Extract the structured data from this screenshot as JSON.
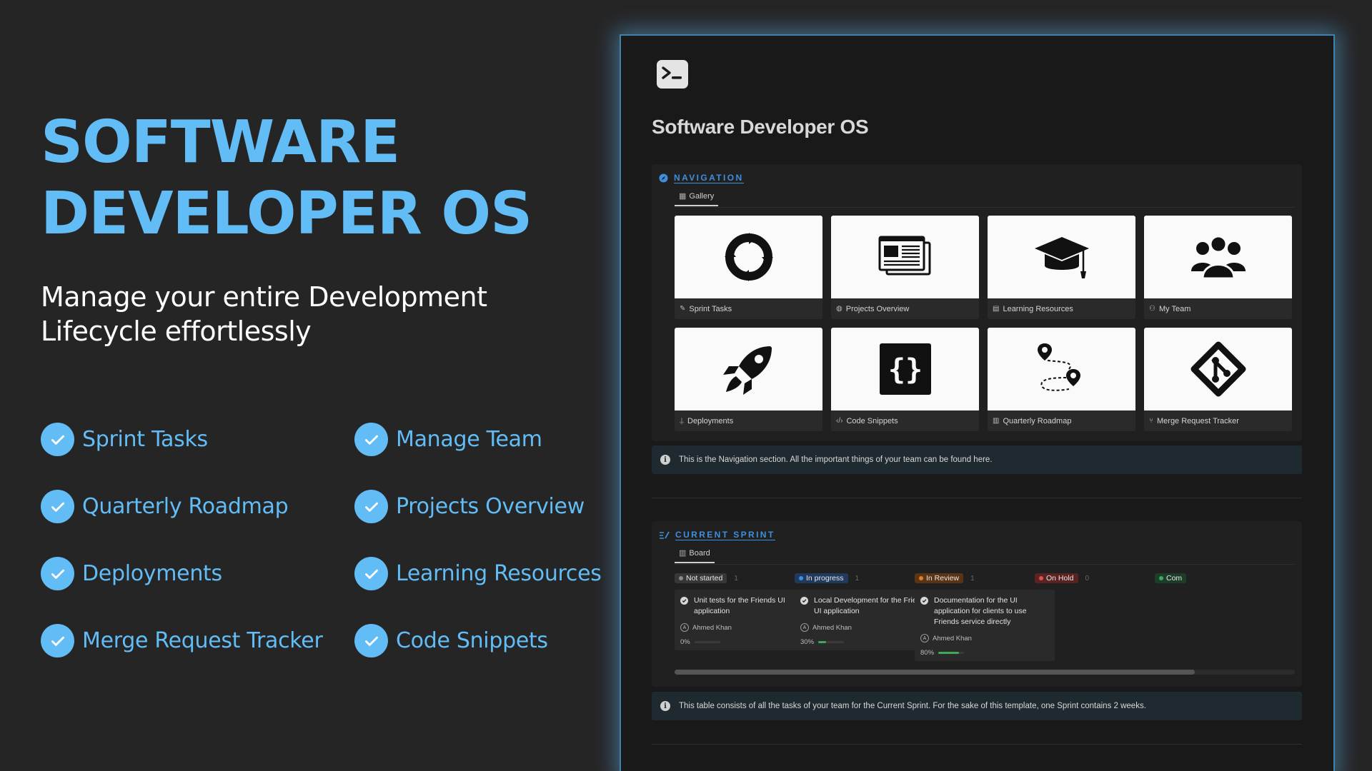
{
  "hero": {
    "title_line1": "SOFTWARE",
    "title_line2": "DEVELOPER OS",
    "subtitle_line1": "Manage your entire Development",
    "subtitle_line2": "Lifecycle effortlessly"
  },
  "features": [
    "Sprint Tasks",
    "Manage Team",
    "Quarterly Roadmap",
    "Projects Overview",
    "Deployments",
    "Learning Resources",
    "Merge Request Tracker",
    "Code Snippets"
  ],
  "colors": {
    "accent": "#62bdf6",
    "background": "#252526",
    "window_bg": "#191919",
    "link_blue": "#3d8fe0"
  },
  "window": {
    "page_icon": "terminal-icon",
    "page_title": "Software Developer OS",
    "navigation": {
      "title": "NAVIGATION",
      "view_tab": "Gallery",
      "cards": [
        {
          "label": "Sprint Tasks",
          "icon": "cycle-icon"
        },
        {
          "label": "Projects Overview",
          "icon": "browser-windows-icon"
        },
        {
          "label": "Learning Resources",
          "icon": "graduation-cap-icon"
        },
        {
          "label": "My Team",
          "icon": "team-icon"
        },
        {
          "label": "Deployments",
          "icon": "rocket-icon"
        },
        {
          "label": "Code Snippets",
          "icon": "braces-icon"
        },
        {
          "label": "Quarterly Roadmap",
          "icon": "route-icon"
        },
        {
          "label": "Merge Request Tracker",
          "icon": "git-icon"
        }
      ],
      "callout": "This is the Navigation section. All the important things of your team can be found here."
    },
    "sprint": {
      "title": "CURRENT SPRINT",
      "view_tab": "Board",
      "columns": [
        {
          "status": "Not started",
          "count": "1",
          "color": "#8a8a8a",
          "bg": "#373737",
          "task": {
            "title": "Unit tests for the Friends UI application",
            "assignee": "Ahmed Khan",
            "progress_label": "0%",
            "progress": 0
          }
        },
        {
          "status": "In progress",
          "count": "1",
          "color": "#3d8fe0",
          "bg": "#1f3a5c",
          "task": {
            "title": "Local Development for the Friends UI application",
            "assignee": "Ahmed Khan",
            "progress_label": "30%",
            "progress": 0.3
          }
        },
        {
          "status": "In Review",
          "count": "1",
          "color": "#d9822b",
          "bg": "#5a3414",
          "task": {
            "title": "Documentation for the UI application for clients to use Friends service directly",
            "assignee": "Ahmed Khan",
            "progress_label": "80%",
            "progress": 0.8
          }
        },
        {
          "status": "On Hold",
          "count": "0",
          "color": "#d9534f",
          "bg": "#5a2220",
          "task": null
        },
        {
          "status": "Com",
          "count": "",
          "color": "#3fa95a",
          "bg": "#1e3d29",
          "task": null
        }
      ],
      "callout": "This table consists of all the tasks of your team for the Current Sprint. For the sake of this template, one Sprint contains 2 weeks."
    }
  }
}
